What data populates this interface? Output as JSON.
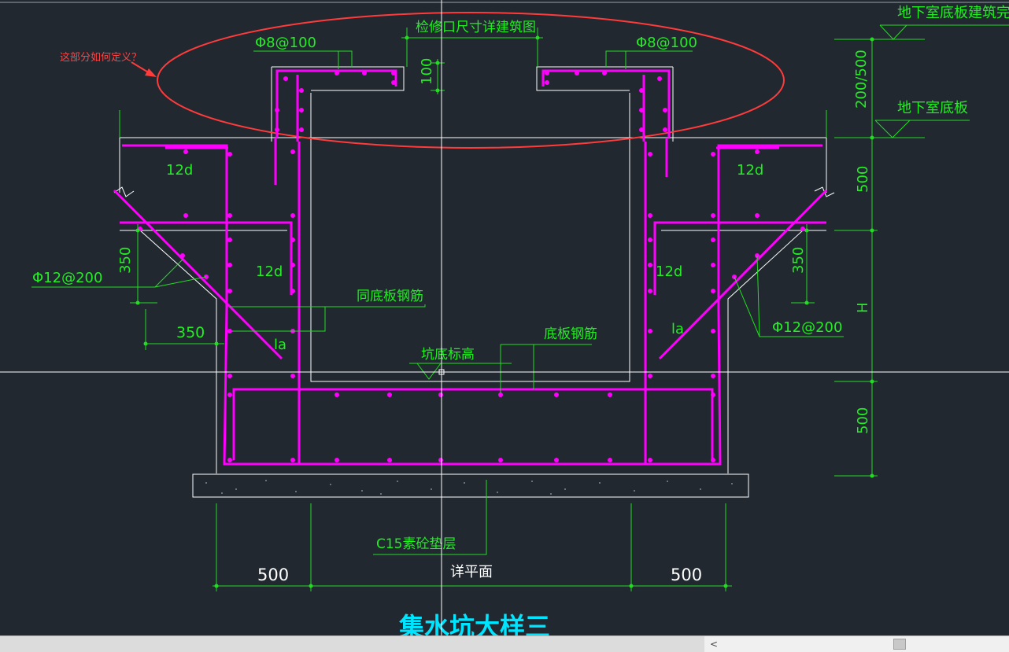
{
  "drawing": {
    "top_label": "检修口尺寸详建筑图",
    "question_annotation": "这部分如何定义？",
    "rebar_left_top": "Φ8@100",
    "rebar_right_top": "Φ8@100",
    "dim_100": "100",
    "dim_200_500": "200/500",
    "level_top": "地下室底板建筑完",
    "level_slab": "地下室底板",
    "dim_500_right_top": "500",
    "dim_H": "H",
    "dim_500_right_bottom": "500",
    "len_12d_tl": "12d",
    "len_12d_tr": "12d",
    "len_12d_ml": "12d",
    "len_12d_mr": "12d",
    "la_left": "la",
    "la_right": "la",
    "dim_350_left_v": "350",
    "dim_350_left_h": "350",
    "dim_350_right_v": "350",
    "rebar_left_slope": "Φ12@200",
    "rebar_right_slope": "Φ12@200",
    "same_slab_rebar": "同底板钢筋",
    "slab_rebar": "底板钢筋",
    "pit_bottom_level": "坑底标高",
    "cushion": "C15素砼垫层",
    "dim_500_bottom_left": "500",
    "dim_500_bottom_right": "500",
    "see_plan": "详平面",
    "drawing_title": "集水坑大样三"
  },
  "colors": {
    "background": "#212830",
    "rebar": "#ff00ff",
    "dimension": "#00ff00",
    "concrete": "#ffffff",
    "annotation": "#ff3333",
    "title": "#00e5ff",
    "crosshair": "#ffffff"
  },
  "scrollbar": {
    "left_arrow": "<"
  }
}
